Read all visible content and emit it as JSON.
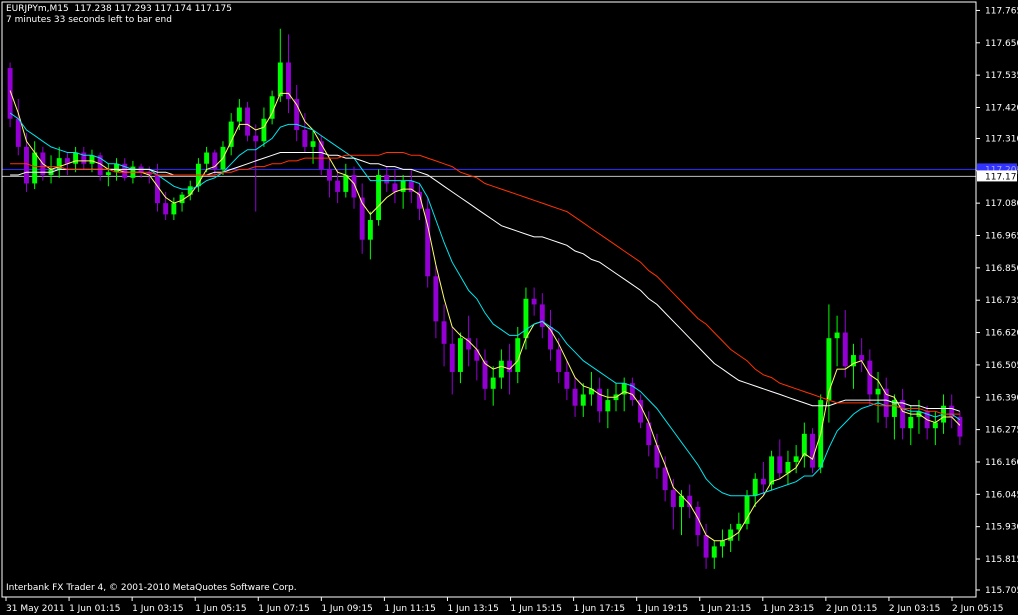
{
  "header": {
    "symbol_line": "EURJPYm,M15  117.238 117.293 117.174 117.175",
    "countdown": "7 minutes 33 seconds left to bar end"
  },
  "footer": {
    "copyright": "Interbank FX Trader 4, © 2001-2010 MetaQuotes Software Corp."
  },
  "colors": {
    "background": "#000000",
    "axis": "#ffffff",
    "bull_candle": "#00ff00",
    "bear_candle": "#9400d3",
    "ma_fast": "#ffff66",
    "ma_mid": "#00e5ee",
    "ma_slow": "#ffffff",
    "ma_long": "#ff3300",
    "blue_line": "#3333ff"
  },
  "chart_data": {
    "type": "candlestick",
    "title": "",
    "xlabel": "",
    "ylabel": "",
    "ylim": [
      115.68,
      117.795
    ],
    "y_ticks": [
      "117.765",
      "117.650",
      "117.535",
      "117.420",
      "117.310",
      "117.195",
      "117.080",
      "116.965",
      "116.850",
      "116.735",
      "116.620",
      "116.505",
      "116.390",
      "116.275",
      "116.160",
      "116.045",
      "115.930",
      "115.815",
      "115.705"
    ],
    "x_ticks": [
      "31 May 2011",
      "1 Jun 01:15",
      "1 Jun 03:15",
      "1 Jun 05:15",
      "1 Jun 07:15",
      "1 Jun 09:15",
      "1 Jun 11:15",
      "1 Jun 13:15",
      "1 Jun 15:15",
      "1 Jun 17:15",
      "1 Jun 19:15",
      "1 Jun 21:15",
      "1 Jun 23:15",
      "2 Jun 01:15",
      "2 Jun 03:15",
      "2 Jun 05:15"
    ],
    "current_price": "117.175",
    "blue_level": "117.20",
    "blue_level_tag": "117.205",
    "candles_ohlc": [
      [
        117.56,
        117.58,
        117.35,
        117.38
      ],
      [
        117.38,
        117.45,
        117.25,
        117.28
      ],
      [
        117.28,
        117.33,
        117.12,
        117.15
      ],
      [
        117.15,
        117.3,
        117.13,
        117.26
      ],
      [
        117.26,
        117.28,
        117.16,
        117.18
      ],
      [
        117.18,
        117.25,
        117.15,
        117.2
      ],
      [
        117.2,
        117.28,
        117.17,
        117.24
      ],
      [
        117.24,
        117.26,
        117.18,
        117.22
      ],
      [
        117.22,
        117.28,
        117.19,
        117.26
      ],
      [
        117.26,
        117.28,
        117.2,
        117.22
      ],
      [
        117.22,
        117.27,
        117.19,
        117.25
      ],
      [
        117.25,
        117.26,
        117.16,
        117.18
      ],
      [
        117.18,
        117.22,
        117.14,
        117.19
      ],
      [
        117.19,
        117.24,
        117.16,
        117.22
      ],
      [
        117.22,
        117.24,
        117.16,
        117.17
      ],
      [
        117.17,
        117.23,
        117.15,
        117.21
      ],
      [
        117.21,
        117.22,
        117.17,
        117.19
      ],
      [
        117.19,
        117.21,
        117.15,
        117.18
      ],
      [
        117.18,
        117.22,
        117.05,
        117.08
      ],
      [
        117.08,
        117.12,
        117.02,
        117.04
      ],
      [
        117.04,
        117.1,
        117.02,
        117.08
      ],
      [
        117.08,
        117.12,
        117.05,
        117.11
      ],
      [
        117.11,
        117.16,
        117.09,
        117.14
      ],
      [
        117.14,
        117.24,
        117.12,
        117.22
      ],
      [
        117.22,
        117.28,
        117.19,
        117.26
      ],
      [
        117.26,
        117.27,
        117.18,
        117.2
      ],
      [
        117.2,
        117.3,
        117.18,
        117.28
      ],
      [
        117.28,
        117.4,
        117.25,
        117.37
      ],
      [
        117.37,
        117.45,
        117.34,
        117.42
      ],
      [
        117.42,
        117.44,
        117.3,
        117.32
      ],
      [
        117.32,
        117.36,
        117.05,
        117.3
      ],
      [
        117.3,
        117.42,
        117.28,
        117.38
      ],
      [
        117.38,
        117.48,
        117.36,
        117.46
      ],
      [
        117.46,
        117.7,
        117.44,
        117.58
      ],
      [
        117.58,
        117.68,
        117.4,
        117.45
      ],
      [
        117.45,
        117.5,
        117.3,
        117.34
      ],
      [
        117.34,
        117.4,
        117.26,
        117.28
      ],
      [
        117.28,
        117.34,
        117.22,
        117.3
      ],
      [
        117.3,
        117.32,
        117.18,
        117.2
      ],
      [
        117.2,
        117.24,
        117.1,
        117.16
      ],
      [
        117.16,
        117.2,
        117.08,
        117.12
      ],
      [
        117.12,
        117.22,
        117.1,
        117.18
      ],
      [
        117.18,
        117.21,
        117.06,
        117.1
      ],
      [
        117.1,
        117.15,
        116.9,
        116.95
      ],
      [
        116.95,
        117.05,
        116.88,
        117.02
      ],
      [
        117.02,
        117.2,
        117.0,
        117.18
      ],
      [
        117.18,
        117.21,
        117.12,
        117.15
      ],
      [
        117.15,
        117.2,
        117.08,
        117.12
      ],
      [
        117.12,
        117.18,
        117.06,
        117.16
      ],
      [
        117.16,
        117.2,
        117.08,
        117.12
      ],
      [
        117.12,
        117.15,
        117.02,
        117.06
      ],
      [
        117.06,
        117.1,
        116.78,
        116.82
      ],
      [
        116.82,
        116.86,
        116.6,
        116.66
      ],
      [
        116.66,
        116.72,
        116.5,
        116.58
      ],
      [
        116.58,
        116.64,
        116.4,
        116.48
      ],
      [
        116.48,
        116.62,
        116.44,
        116.6
      ],
      [
        116.6,
        116.68,
        116.5,
        116.56
      ],
      [
        116.56,
        116.6,
        116.45,
        116.52
      ],
      [
        116.52,
        116.56,
        116.38,
        116.42
      ],
      [
        116.42,
        116.5,
        116.36,
        116.46
      ],
      [
        116.46,
        116.56,
        116.42,
        116.52
      ],
      [
        116.52,
        116.58,
        116.4,
        116.48
      ],
      [
        116.48,
        116.64,
        116.44,
        116.6
      ],
      [
        116.6,
        116.78,
        116.56,
        116.74
      ],
      [
        116.74,
        116.78,
        116.68,
        116.72
      ],
      [
        116.72,
        116.76,
        116.6,
        116.64
      ],
      [
        116.64,
        116.7,
        116.52,
        116.56
      ],
      [
        116.56,
        116.6,
        116.44,
        116.48
      ],
      [
        116.48,
        116.52,
        116.38,
        116.42
      ],
      [
        116.42,
        116.46,
        116.32,
        116.36
      ],
      [
        116.36,
        116.44,
        116.32,
        116.4
      ],
      [
        116.4,
        116.48,
        116.36,
        116.42
      ],
      [
        116.42,
        116.46,
        116.3,
        116.34
      ],
      [
        116.34,
        116.42,
        116.28,
        116.38
      ],
      [
        116.38,
        116.44,
        116.34,
        116.4
      ],
      [
        116.4,
        116.46,
        116.34,
        116.44
      ],
      [
        116.44,
        116.46,
        116.36,
        116.38
      ],
      [
        116.38,
        116.4,
        116.28,
        116.3
      ],
      [
        116.3,
        116.34,
        116.18,
        116.22
      ],
      [
        116.22,
        116.26,
        116.1,
        116.14
      ],
      [
        116.14,
        116.18,
        116.02,
        116.06
      ],
      [
        116.06,
        116.1,
        115.92,
        116.0
      ],
      [
        116.0,
        116.06,
        115.9,
        116.04
      ],
      [
        116.04,
        116.08,
        115.96,
        116.0
      ],
      [
        116.0,
        116.02,
        115.86,
        115.9
      ],
      [
        115.9,
        115.94,
        115.78,
        115.82
      ],
      [
        115.82,
        115.88,
        115.78,
        115.86
      ],
      [
        115.86,
        115.92,
        115.82,
        115.88
      ],
      [
        115.88,
        115.94,
        115.84,
        115.92
      ],
      [
        115.92,
        115.98,
        115.88,
        115.94
      ],
      [
        115.94,
        116.06,
        115.92,
        116.04
      ],
      [
        116.04,
        116.12,
        116.0,
        116.1
      ],
      [
        116.1,
        116.16,
        116.04,
        116.08
      ],
      [
        116.08,
        116.2,
        116.06,
        116.18
      ],
      [
        116.18,
        116.24,
        116.1,
        116.12
      ],
      [
        116.12,
        116.2,
        116.08,
        116.16
      ],
      [
        116.16,
        116.22,
        116.12,
        116.18
      ],
      [
        116.18,
        116.3,
        116.14,
        116.26
      ],
      [
        116.26,
        116.28,
        116.12,
        116.14
      ],
      [
        116.14,
        116.4,
        116.12,
        116.38
      ],
      [
        116.38,
        116.72,
        116.3,
        116.6
      ],
      [
        116.6,
        116.68,
        116.5,
        116.62
      ],
      [
        116.62,
        116.7,
        116.46,
        116.5
      ],
      [
        116.5,
        116.58,
        116.42,
        116.54
      ],
      [
        116.54,
        116.6,
        116.48,
        116.52
      ],
      [
        116.52,
        116.56,
        116.36,
        116.4
      ],
      [
        116.4,
        116.48,
        116.3,
        116.42
      ],
      [
        116.42,
        116.46,
        116.28,
        116.32
      ],
      [
        116.32,
        116.4,
        116.24,
        116.38
      ],
      [
        116.38,
        116.42,
        116.24,
        116.28
      ],
      [
        116.28,
        116.36,
        116.22,
        116.32
      ],
      [
        116.32,
        116.38,
        116.26,
        116.34
      ],
      [
        116.34,
        116.36,
        116.24,
        116.28
      ],
      [
        116.28,
        116.34,
        116.22,
        116.3
      ],
      [
        116.3,
        116.4,
        116.26,
        116.36
      ],
      [
        116.36,
        116.4,
        116.28,
        116.32
      ],
      [
        116.32,
        116.34,
        116.22,
        116.25
      ]
    ],
    "series": [
      {
        "color": "#ffff66",
        "values": [
          117.48,
          117.4,
          117.3,
          117.26,
          117.22,
          117.2,
          117.21,
          117.22,
          117.23,
          117.23,
          117.23,
          117.22,
          117.2,
          117.2,
          117.19,
          117.19,
          117.19,
          117.18,
          117.14,
          117.1,
          117.08,
          117.09,
          117.11,
          117.15,
          117.2,
          117.21,
          117.24,
          117.3,
          117.36,
          117.36,
          117.34,
          117.35,
          117.4,
          117.47,
          117.47,
          117.43,
          117.37,
          117.34,
          117.29,
          117.24,
          117.19,
          117.18,
          117.15,
          117.08,
          117.04,
          117.07,
          117.1,
          117.12,
          117.13,
          117.13,
          117.11,
          117.0,
          116.86,
          116.74,
          116.64,
          116.61,
          116.59,
          116.56,
          116.51,
          116.49,
          116.5,
          116.49,
          116.52,
          116.6,
          116.65,
          116.66,
          116.63,
          116.58,
          116.52,
          116.46,
          116.43,
          116.42,
          116.4,
          116.39,
          116.39,
          116.41,
          116.4,
          116.36,
          116.3,
          116.22,
          116.15,
          116.07,
          116.04,
          116.01,
          115.96,
          115.9,
          115.88,
          115.88,
          115.89,
          115.91,
          115.96,
          116.01,
          116.04,
          116.09,
          116.1,
          116.12,
          116.14,
          116.19,
          116.17,
          116.26,
          116.41,
          116.49,
          116.49,
          116.51,
          116.52,
          116.47,
          116.45,
          116.4,
          116.39,
          116.34,
          116.33,
          116.33,
          116.31,
          116.3,
          116.32,
          116.32,
          116.29
        ]
      },
      {
        "color": "#00e5ee",
        "values": [
          117.4,
          117.38,
          117.34,
          117.32,
          117.3,
          117.28,
          117.27,
          117.26,
          117.26,
          117.25,
          117.25,
          117.24,
          117.22,
          117.22,
          117.21,
          117.2,
          117.2,
          117.2,
          117.18,
          117.16,
          117.14,
          117.13,
          117.13,
          117.14,
          117.16,
          117.17,
          117.19,
          117.22,
          117.25,
          117.27,
          117.27,
          117.29,
          117.31,
          117.35,
          117.36,
          117.36,
          117.35,
          117.34,
          117.32,
          117.3,
          117.28,
          117.26,
          117.24,
          117.2,
          117.16,
          117.16,
          117.16,
          117.16,
          117.16,
          117.16,
          117.15,
          117.1,
          117.02,
          116.94,
          116.87,
          116.82,
          116.77,
          116.74,
          116.69,
          116.65,
          116.63,
          116.61,
          116.61,
          116.63,
          116.65,
          116.66,
          116.64,
          116.62,
          116.58,
          116.55,
          116.52,
          116.5,
          116.48,
          116.46,
          116.44,
          116.44,
          116.43,
          116.41,
          116.38,
          116.35,
          116.31,
          116.27,
          116.23,
          116.19,
          116.15,
          116.1,
          116.07,
          116.05,
          116.04,
          116.04,
          116.04,
          116.04,
          116.05,
          116.06,
          116.07,
          116.08,
          116.09,
          116.11,
          116.11,
          116.14,
          116.21,
          116.27,
          116.3,
          116.33,
          116.35,
          116.36,
          116.37,
          116.36,
          116.36,
          116.35,
          116.34,
          116.34,
          116.33,
          116.32,
          116.33,
          116.33,
          116.31
        ]
      },
      {
        "color": "#ffffff",
        "values": [
          117.18,
          117.18,
          117.19,
          117.19,
          117.19,
          117.19,
          117.2,
          117.2,
          117.2,
          117.2,
          117.2,
          117.2,
          117.2,
          117.2,
          117.2,
          117.2,
          117.2,
          117.2,
          117.19,
          117.19,
          117.18,
          117.18,
          117.18,
          117.18,
          117.18,
          117.19,
          117.19,
          117.2,
          117.21,
          117.22,
          117.23,
          117.24,
          117.25,
          117.26,
          117.26,
          117.26,
          117.26,
          117.26,
          117.26,
          117.25,
          117.25,
          117.24,
          117.24,
          117.23,
          117.22,
          117.22,
          117.21,
          117.21,
          117.2,
          117.2,
          117.19,
          117.18,
          117.16,
          117.14,
          117.12,
          117.1,
          117.08,
          117.06,
          117.04,
          117.02,
          117.0,
          116.99,
          116.98,
          116.97,
          116.96,
          116.96,
          116.95,
          116.94,
          116.93,
          116.91,
          116.9,
          116.88,
          116.87,
          116.85,
          116.83,
          116.81,
          116.79,
          116.77,
          116.74,
          116.72,
          116.69,
          116.66,
          116.63,
          116.6,
          116.57,
          116.54,
          116.51,
          116.49,
          116.47,
          116.45,
          116.44,
          116.43,
          116.42,
          116.41,
          116.4,
          116.39,
          116.38,
          116.37,
          116.36,
          116.36,
          116.36,
          116.37,
          116.38,
          116.38,
          116.38,
          116.38,
          116.38,
          116.38,
          116.37,
          116.37,
          116.36,
          116.36,
          116.35,
          116.35,
          116.35,
          116.35,
          116.34
        ]
      },
      {
        "color": "#ff3300",
        "values": [
          117.22,
          117.22,
          117.22,
          117.21,
          117.21,
          117.21,
          117.21,
          117.2,
          117.2,
          117.2,
          117.2,
          117.2,
          117.2,
          117.19,
          117.19,
          117.19,
          117.19,
          117.19,
          117.18,
          117.18,
          117.18,
          117.18,
          117.18,
          117.18,
          117.18,
          117.18,
          117.19,
          117.19,
          117.2,
          117.2,
          117.21,
          117.21,
          117.22,
          117.22,
          117.23,
          117.23,
          117.24,
          117.24,
          117.24,
          117.24,
          117.24,
          117.25,
          117.25,
          117.25,
          117.25,
          117.25,
          117.26,
          117.26,
          117.26,
          117.25,
          117.25,
          117.24,
          117.23,
          117.22,
          117.21,
          117.19,
          117.18,
          117.17,
          117.15,
          117.14,
          117.13,
          117.12,
          117.11,
          117.1,
          117.09,
          117.08,
          117.07,
          117.06,
          117.05,
          117.03,
          117.01,
          116.99,
          116.97,
          116.95,
          116.93,
          116.91,
          116.89,
          116.87,
          116.84,
          116.82,
          116.79,
          116.76,
          116.73,
          116.7,
          116.67,
          116.65,
          116.62,
          116.59,
          116.56,
          116.54,
          116.52,
          116.49,
          116.47,
          116.46,
          116.44,
          116.43,
          116.42,
          116.41,
          116.4,
          116.39,
          116.38,
          116.37,
          116.37,
          116.37,
          116.37,
          116.37,
          116.36,
          116.36,
          116.36,
          116.35,
          116.35,
          116.35,
          116.34,
          116.34,
          116.33,
          116.33,
          116.33
        ]
      }
    ]
  }
}
